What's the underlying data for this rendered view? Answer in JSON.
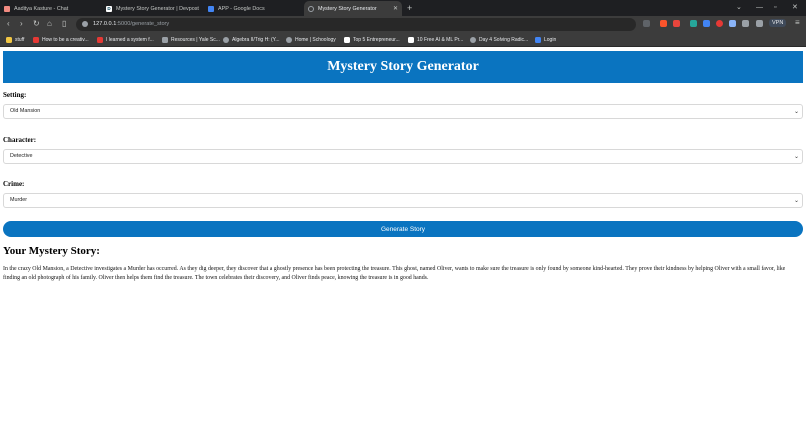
{
  "browser": {
    "tabs": [
      {
        "title": "Aaditya Kasture - Chat",
        "active": false,
        "icon": "chat-favicon",
        "color": "#f28b82"
      },
      {
        "title": "Mystery Story Generator | Devpost",
        "active": false,
        "icon": "devpost-favicon",
        "color": "#ffffff"
      },
      {
        "title": "APP - Google Docs",
        "active": false,
        "icon": "docs-favicon",
        "color": "#4285f4"
      },
      {
        "title": "Mystery Story Generator",
        "active": true,
        "icon": "globe-favicon",
        "color": "#9aa0a6"
      }
    ],
    "url_host": "127.0.0.1",
    "url_rest": ":5000/generate_story",
    "vpn_label": "VPN",
    "bookmarks": [
      {
        "label": "stuff",
        "color": "#f2c744"
      },
      {
        "label": "How to be a creativ...",
        "color": "#e53935"
      },
      {
        "label": "I learned a system f...",
        "color": "#e53935"
      },
      {
        "label": "Resources | Yale Sc...",
        "color": "#9aa0a6"
      },
      {
        "label": "Algebra II/Trig H: (Y...",
        "color": "#9aa0a6"
      },
      {
        "label": "Home | Schoology",
        "color": "#9aa0a6"
      },
      {
        "label": "Top 5 Entrepreneur...",
        "color": "#ffffff"
      },
      {
        "label": "10 Free AI & ML Pr...",
        "color": "#ffffff"
      },
      {
        "label": "Day 4 Solving Radic...",
        "color": "#9aa0a6"
      },
      {
        "label": "Login",
        "color": "#4285f4"
      }
    ]
  },
  "page": {
    "title": "Mystery Story Generator",
    "setting": {
      "label": "Setting:",
      "value": "Old Mansion"
    },
    "character": {
      "label": "Character:",
      "value": "Detective"
    },
    "crime": {
      "label": "Crime:",
      "value": "Murder"
    },
    "generate_button": "Generate Story",
    "story_heading": "Your Mystery Story:",
    "story_text": "In the crazy Old Mansion, a Detective investigates a Murder has occurred. As they dig deeper, they discover that a ghostly presence has been protecting the treasure. This ghost, named Oliver, wants to make sure the treasure is only found by someone kind-hearted. They prove their kindness by helping Oliver with a small favor, like finding an old photograph of his family. Oliver then helps them find the treasure. The town celebrates their discovery, and Oliver finds peace, knowing the treasure is in good hands."
  },
  "colors": {
    "accent": "#0a74c0",
    "chrome_dark": "#1e1f22",
    "chrome_toolbar": "#3c3c3c"
  }
}
